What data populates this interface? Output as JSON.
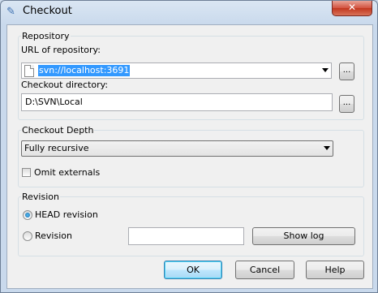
{
  "window": {
    "title": "Checkout",
    "close_glyph": "✕"
  },
  "repository": {
    "group_label": "Repository",
    "url_label": "URL of repository:",
    "url_value": "svn://localhost:3691",
    "browse_label": "...",
    "dir_label": "Checkout directory:",
    "dir_value": "D:\\SVN\\Local",
    "dir_browse_label": "..."
  },
  "depth": {
    "group_label": "Checkout Depth",
    "selected": "Fully recursive",
    "omit_externals_label": "Omit externals",
    "omit_externals_checked": false
  },
  "revision": {
    "group_label": "Revision",
    "head_label": "HEAD revision",
    "head_checked": true,
    "revision_label": "Revision",
    "revision_value": "",
    "show_log_label": "Show log"
  },
  "buttons": {
    "ok": "OK",
    "cancel": "Cancel",
    "help": "Help"
  }
}
